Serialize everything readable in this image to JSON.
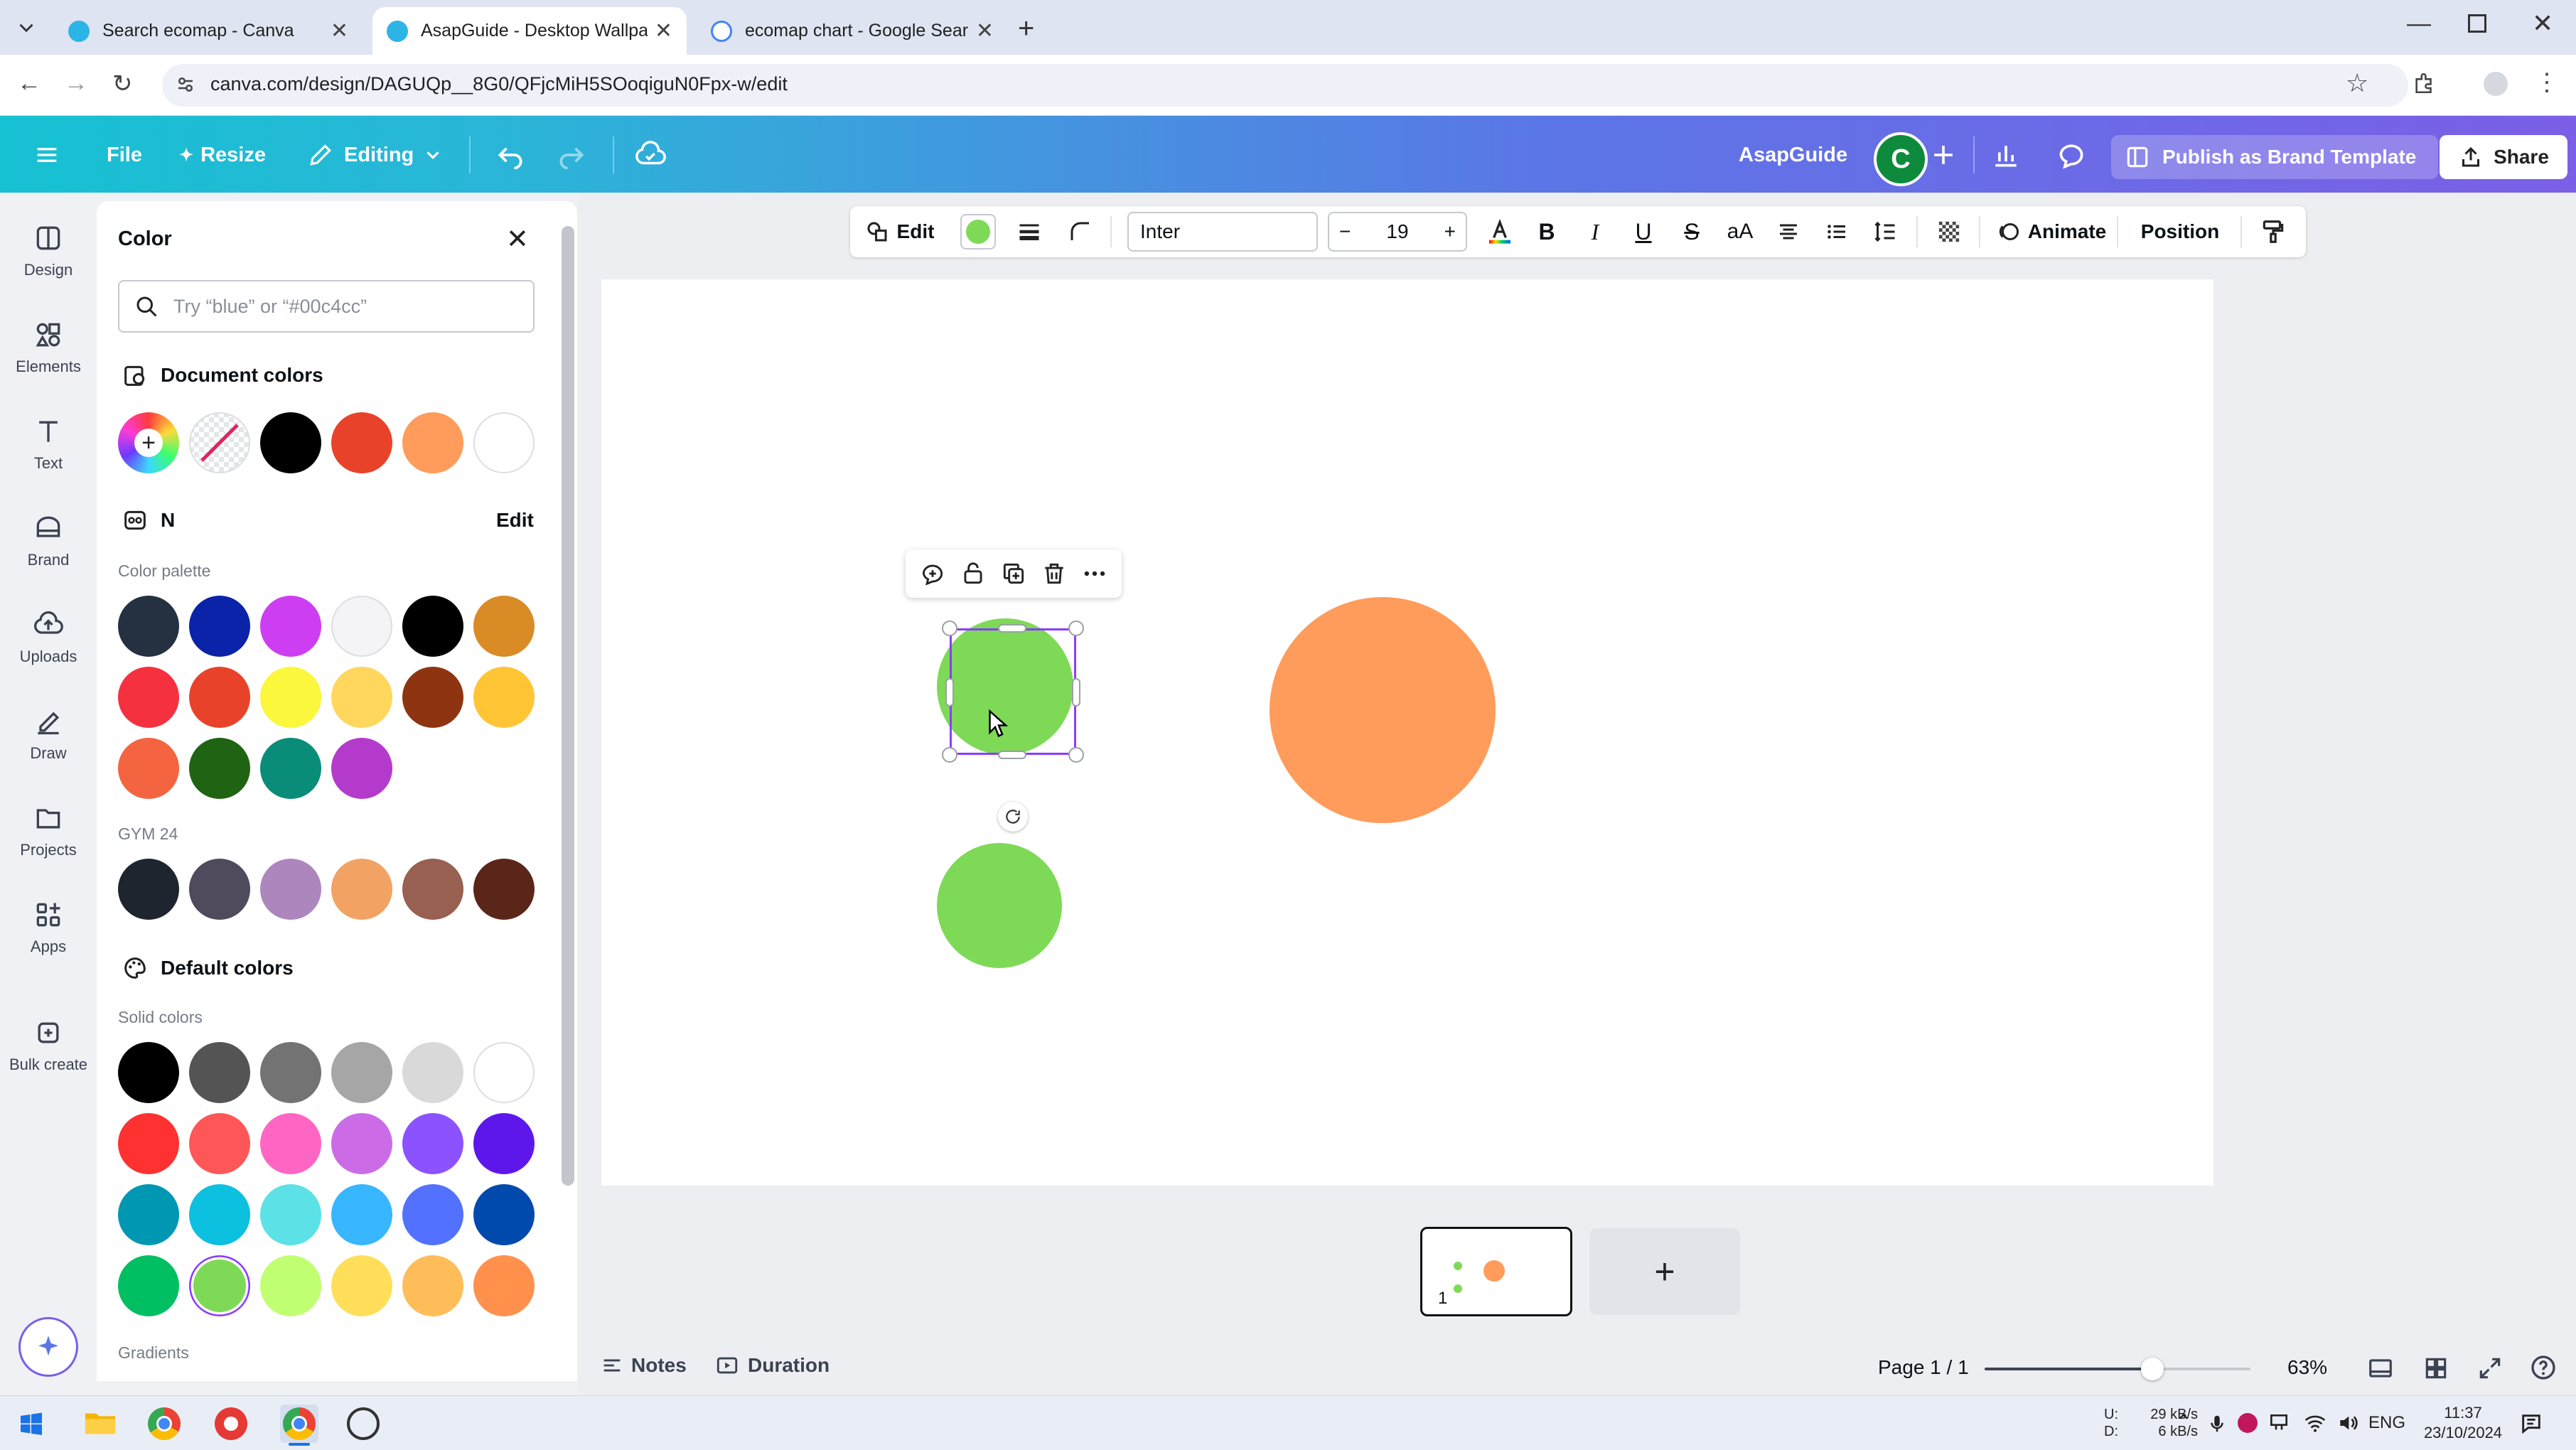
{
  "browser": {
    "tabs": [
      {
        "title": "Search ecomap - Canva",
        "active": false,
        "favicon_color": "#2cb4e6"
      },
      {
        "title": "AsapGuide - Desktop Wallpape",
        "active": true,
        "favicon_color": "#2cb4e6"
      },
      {
        "title": "ecomap chart - Google Search",
        "active": false,
        "favicon_color": "#4285f4"
      }
    ],
    "url": "canva.com/design/DAGUQp__8G0/QFjcMiH5SOoqiguN0Fpx-w/edit"
  },
  "header": {
    "file_label": "File",
    "resize_label": "Resize",
    "editing_label": "Editing",
    "team_name": "AsapGuide",
    "avatar_letter": "C",
    "publish_label": "Publish as Brand Template",
    "share_label": "Share"
  },
  "rail": {
    "items": [
      {
        "label": "Design",
        "icon": "design-icon"
      },
      {
        "label": "Elements",
        "icon": "elements-icon"
      },
      {
        "label": "Text",
        "icon": "text-icon"
      },
      {
        "label": "Brand",
        "icon": "brand-icon"
      },
      {
        "label": "Uploads",
        "icon": "uploads-icon"
      },
      {
        "label": "Draw",
        "icon": "draw-icon"
      },
      {
        "label": "Projects",
        "icon": "projects-icon"
      },
      {
        "label": "Apps",
        "icon": "apps-icon"
      },
      {
        "label": "Bulk create",
        "icon": "bulk-create-icon"
      }
    ]
  },
  "color_panel": {
    "title": "Color",
    "search_placeholder": "Try “blue” or “#00c4cc”",
    "document_colors_heading": "Document colors",
    "document_colors": [
      "#000000",
      "#e8432a",
      "#ff9c5b",
      "#ffffff"
    ],
    "brand_kit_name": "N",
    "brand_kit_edit": "Edit",
    "palette_label": "Color palette",
    "palette": [
      "#253041",
      "#0a23a8",
      "#cd3ef2",
      "#f4f4f6",
      "#000000",
      "#d98c26",
      "#f5303f",
      "#e8432a",
      "#fbf73c",
      "#ffd75c",
      "#8e3410",
      "#ffc535",
      "#f46441",
      "#1f6412",
      "#098c78",
      "#b43acc"
    ],
    "gym_label": "GYM 24",
    "gym_colors": [
      "#1e252e",
      "#4f4b5c",
      "#ad86be",
      "#f2a262",
      "#976050",
      "#5a2619"
    ],
    "default_heading": "Default colors",
    "solid_label": "Solid colors",
    "solid_colors": [
      "#000000",
      "#545454",
      "#737373",
      "#a6a6a6",
      "#d9d9d9",
      "#ffffff",
      "#ff3131",
      "#ff5757",
      "#ff66c4",
      "#cb6ce6",
      "#8c52ff",
      "#5e17eb",
      "#0097b2",
      "#0cc0df",
      "#5ce1e6",
      "#38b6ff",
      "#5271ff",
      "#004aad",
      "#00bf63",
      "#7ed957",
      "#c1ff72",
      "#ffde59",
      "#ffbd59",
      "#ff914d"
    ],
    "selected_solid": "#7ed957",
    "gradients_label": "Gradients"
  },
  "toolbar": {
    "edit_label": "Edit",
    "fill_color": "#7ed957",
    "font": "Inter",
    "font_size": "19",
    "minus": "−",
    "plus": "+",
    "animate_label": "Animate",
    "position_label": "Position"
  },
  "canvas": {
    "shapes": [
      {
        "name": "green-circle-selected",
        "color": "#7ed957"
      },
      {
        "name": "green-circle",
        "color": "#7ed957"
      },
      {
        "name": "orange-circle",
        "color": "#ff9c5b"
      }
    ]
  },
  "pages": {
    "thumb_number": "1",
    "add_label": "+"
  },
  "footer": {
    "notes_label": "Notes",
    "duration_label": "Duration",
    "page_indicator": "Page 1 / 1",
    "zoom": "63%",
    "zoom_fraction": 0.63
  },
  "taskbar": {
    "net_up_label": "U:",
    "net_down_label": "D:",
    "net_up": "29 kB/s",
    "net_down": "6 kB/s",
    "language": "ENG",
    "time": "11:37",
    "date": "23/10/2024"
  }
}
